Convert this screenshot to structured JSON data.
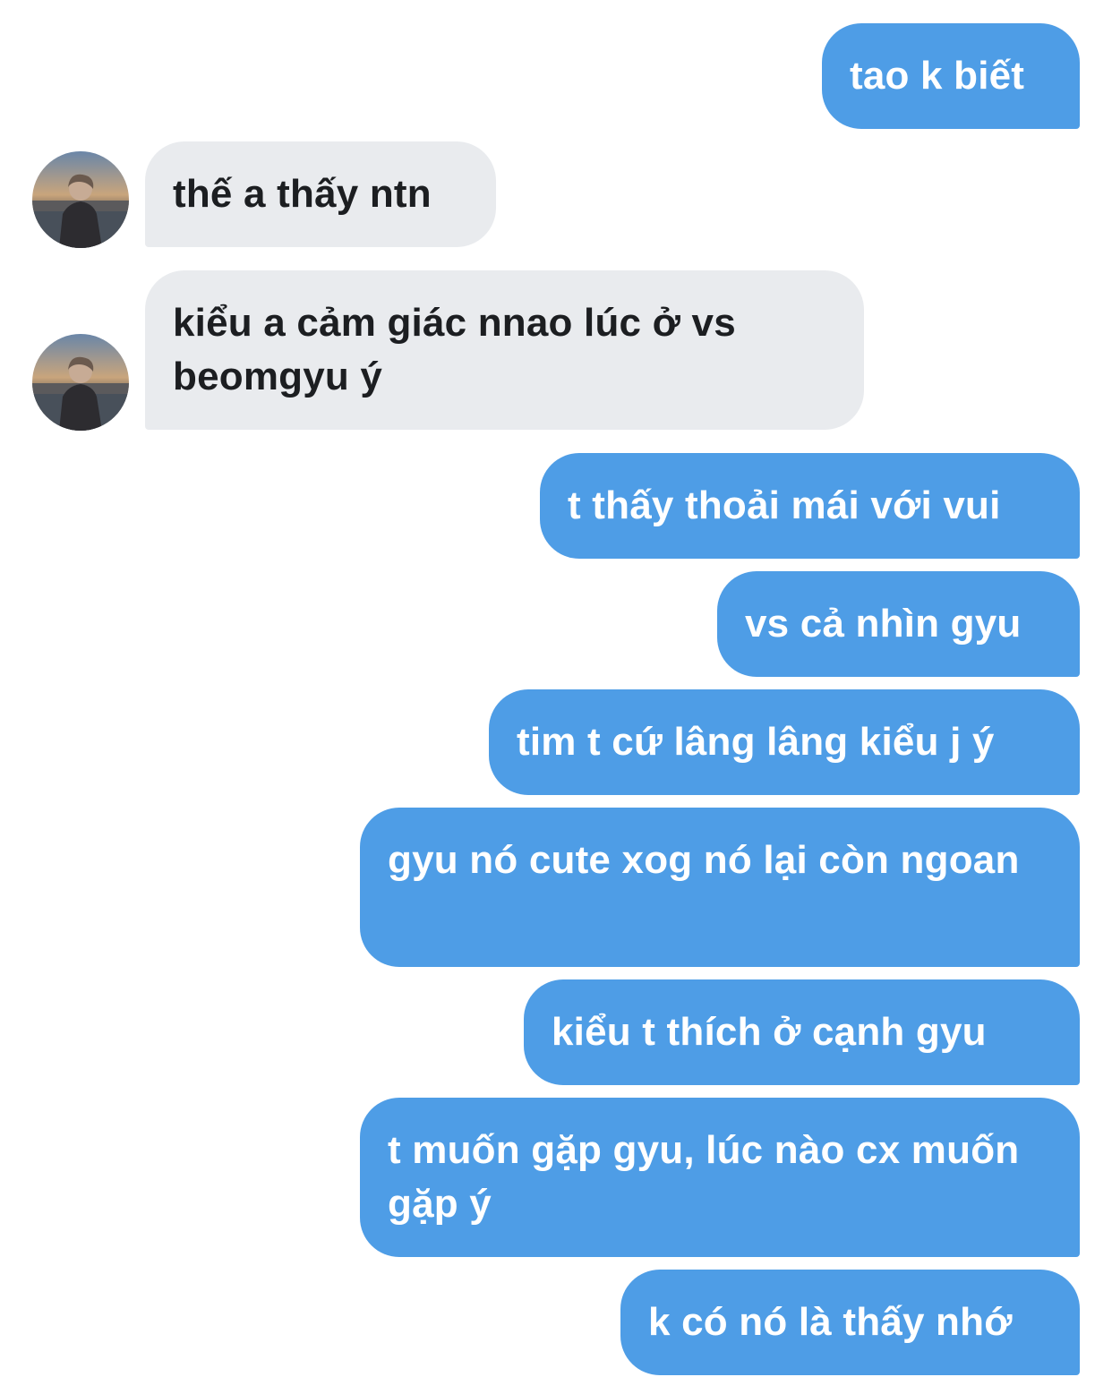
{
  "conversation": {
    "messages": [
      {
        "sender": "me",
        "text": "tao k biết"
      },
      {
        "sender": "other",
        "text": "thế a thấy ntn"
      },
      {
        "sender": "other",
        "text": "kiểu a cảm giác nnao lúc ở vs beomgyu ý"
      },
      {
        "sender": "me",
        "text": "t thấy thoải mái với vui"
      },
      {
        "sender": "me",
        "text": "vs cả nhìn gyu"
      },
      {
        "sender": "me",
        "text": "tim t cứ lâng lâng kiểu j ý"
      },
      {
        "sender": "me",
        "text": "gyu nó cute xog nó lại còn ngoan"
      },
      {
        "sender": "me",
        "text": "kiểu t thích ở cạnh gyu"
      },
      {
        "sender": "me",
        "text": "t muốn gặp gyu, lúc nào cx muốn gặp ý"
      },
      {
        "sender": "me",
        "text": "k có nó là thấy nhớ"
      }
    ]
  },
  "colors": {
    "outgoing_bubble": "#4e9de6",
    "incoming_bubble": "#e9ebee",
    "incoming_text": "#1c1e21",
    "outgoing_text": "#ffffff"
  },
  "icons": {
    "contact_avatar": "contact-avatar-photo"
  }
}
